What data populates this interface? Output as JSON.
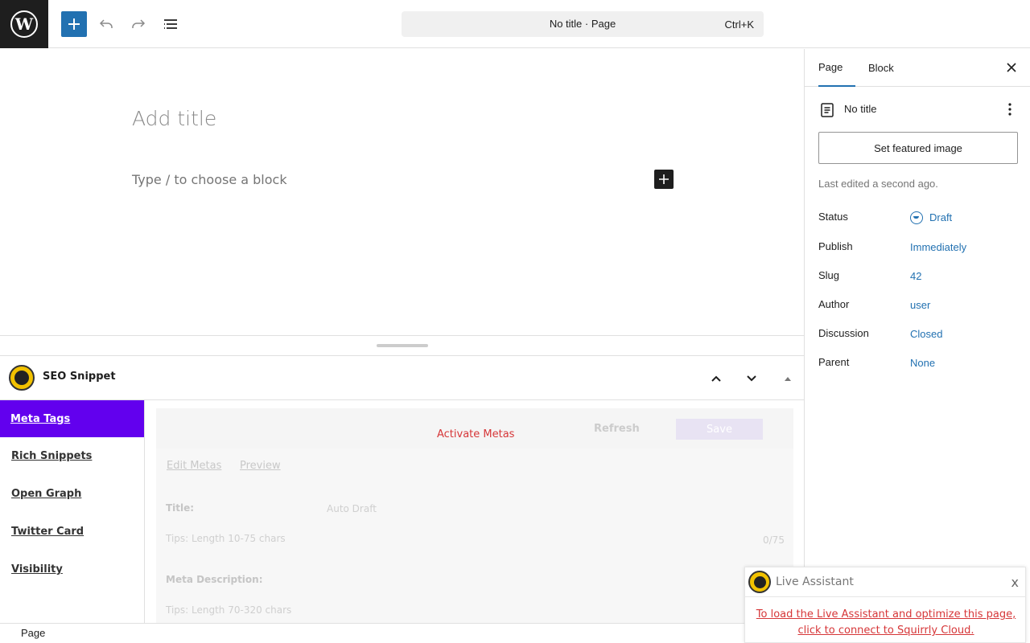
{
  "topbar": {
    "logo_icon": "wordpress-logo-icon",
    "add_icon": "plus-icon",
    "undo_icon": "undo-icon",
    "redo_icon": "redo-icon",
    "listview_icon": "list-view-icon",
    "command_title": "No title · Page",
    "command_shortcut": "Ctrl+K",
    "accent_color": "#2271b1"
  },
  "editor": {
    "title_placeholder": "Add title",
    "block_placeholder": "Type / to choose a block"
  },
  "seo": {
    "title": "SEO Snippet",
    "nav": [
      {
        "label": "Meta Tags",
        "active": true
      },
      {
        "label": "Rich Snippets"
      },
      {
        "label": "Open Graph"
      },
      {
        "label": "Twitter Card"
      },
      {
        "label": "Visibility"
      }
    ],
    "activate": "Activate Metas",
    "refresh": "Refresh",
    "save": "Save",
    "tabs": [
      "Edit Metas",
      "Preview"
    ],
    "title_label": "Title:",
    "title_value": "Auto Draft",
    "title_tip": "Tips: Length 10-75 chars",
    "title_count": "0/75",
    "desc_label": "Meta Description:",
    "desc_tip": "Tips: Length 70-320 chars",
    "nav_active_color": "#6200ee"
  },
  "status_bar": {
    "label": "Page"
  },
  "sidebar": {
    "tabs": [
      "Page",
      "Block"
    ],
    "doc_title": "No title",
    "featured_button": "Set featured image",
    "last_edited": "Last edited a second ago.",
    "props": [
      {
        "label": "Status",
        "value": "Draft"
      },
      {
        "label": "Publish",
        "value": "Immediately"
      },
      {
        "label": "Slug",
        "value": "42"
      },
      {
        "label": "Author",
        "value": "user"
      },
      {
        "label": "Discussion",
        "value": "Closed"
      },
      {
        "label": "Parent",
        "value": "None"
      }
    ]
  },
  "live_assistant": {
    "title": "Live Assistant",
    "close": "x",
    "message": "To load the Live Assistant and optimize this page, click to connect to Squirrly Cloud."
  }
}
